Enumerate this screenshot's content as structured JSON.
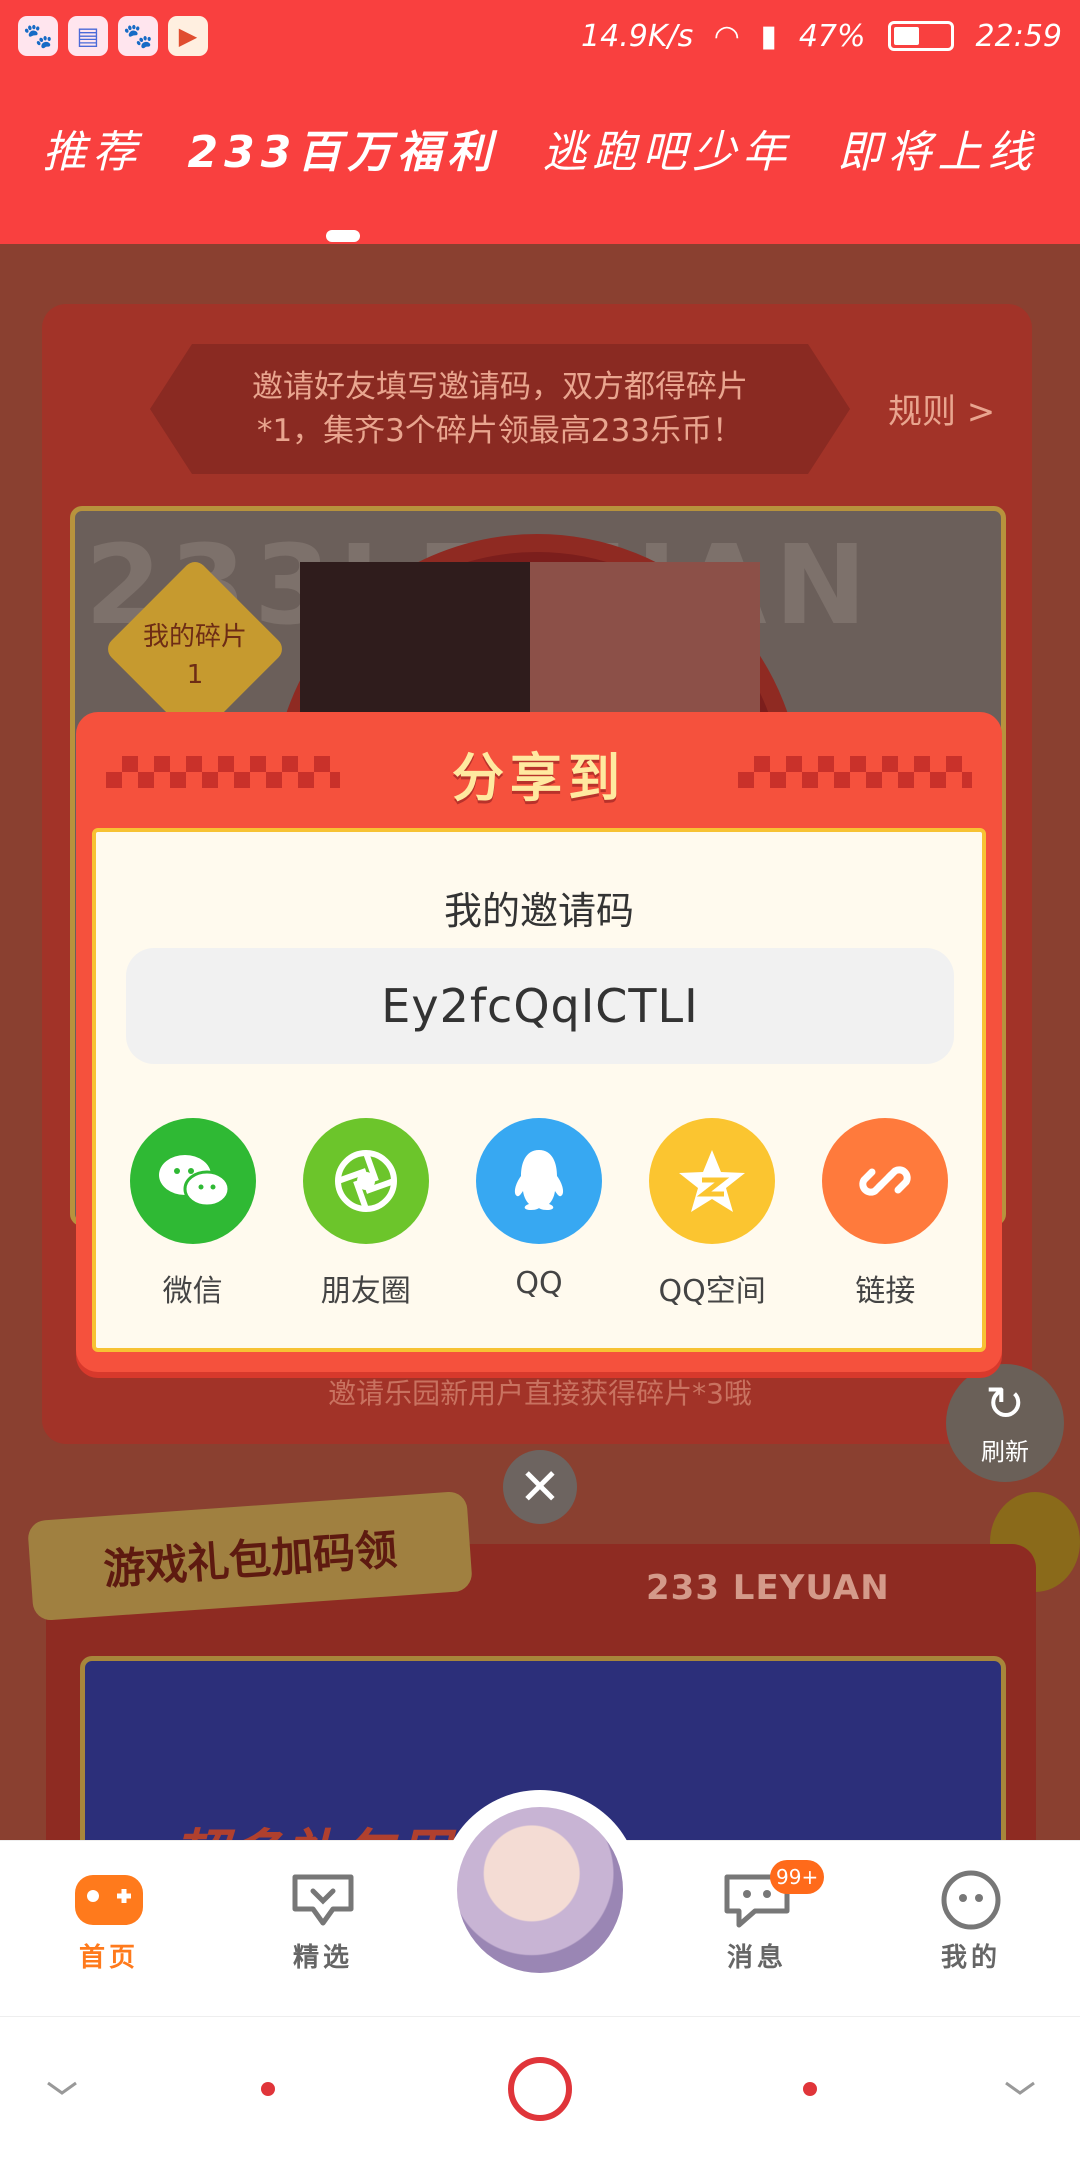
{
  "status": {
    "speed": "14.9K/s",
    "battery": "47%",
    "time": "22:59",
    "battery_level": 0.47
  },
  "top_tabs": [
    "推荐",
    "233百万福利",
    "逃跑吧少年",
    "即将上线"
  ],
  "active_tab_index": 1,
  "background": {
    "banner_text": "邀请好友填写邀请码，双方都得碎片*1，集齐3个碎片领最高233乐币！",
    "rules_link": "规则 >",
    "watermark": "233LEYUAN",
    "fragment_label": "我的碎片",
    "fragment_count": "1",
    "under_text": "邀请乐园新用户直接获得碎片*3哦",
    "refresh_label": "刷新",
    "gift_title": "游戏礼包加码领",
    "leyuan_label": "233 LEYUAN",
    "gift_banner_text": "超多礼包周边"
  },
  "dialog": {
    "title": "分享到",
    "invite_label": "我的邀请码",
    "invite_code": "Ey2fcQqICTLI",
    "share_options": [
      {
        "label": "微信",
        "icon": "wechat-icon",
        "color": "#2fb934"
      },
      {
        "label": "朋友圈",
        "icon": "moments-icon",
        "color": "#6cc52b"
      },
      {
        "label": "QQ",
        "icon": "qq-icon",
        "color": "#37a8f2"
      },
      {
        "label": "QQ空间",
        "icon": "qzone-icon",
        "color": "#fbc530"
      },
      {
        "label": "链接",
        "icon": "link-icon",
        "color": "#ff7a3c"
      }
    ]
  },
  "bottom_nav": {
    "items": [
      {
        "label": "首页",
        "icon": "gamepad-icon",
        "active": true
      },
      {
        "label": "精选",
        "icon": "heart-chat-icon",
        "active": false
      },
      {
        "label": "消息",
        "icon": "message-icon",
        "active": false
      },
      {
        "label": "我的",
        "icon": "face-icon",
        "active": false
      }
    ],
    "message_badge": "99+"
  },
  "colors": {
    "accent": "#f9403f",
    "active_nav": "#ff7a1c",
    "dialog": "#f5513d"
  }
}
